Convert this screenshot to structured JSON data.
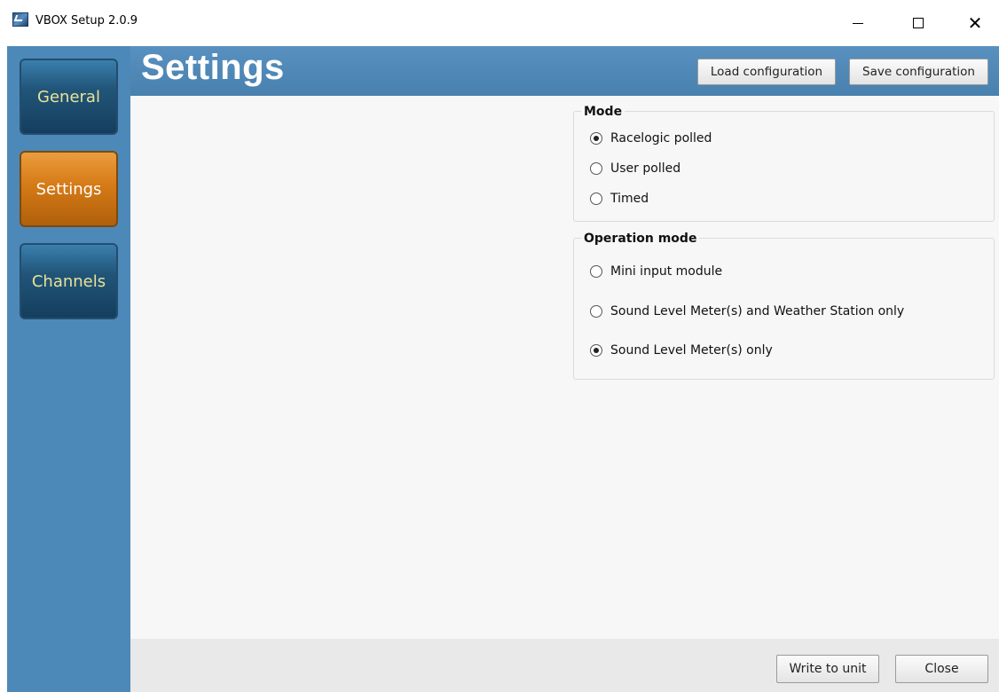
{
  "window": {
    "title": "VBOX Setup 2.0.9",
    "controls": [
      "minimize-icon",
      "maximize-icon",
      "close-icon"
    ]
  },
  "sidebar": {
    "items": [
      {
        "label": "General",
        "active": false
      },
      {
        "label": "Settings",
        "active": true
      },
      {
        "label": "Channels",
        "active": false
      }
    ]
  },
  "header": {
    "title": "Settings",
    "load_label": "Load configuration",
    "save_label": "Save configuration"
  },
  "mode_group": {
    "title": "Mode",
    "options": [
      {
        "label": "Racelogic polled",
        "checked": true
      },
      {
        "label": "User polled",
        "checked": false
      },
      {
        "label": "Timed",
        "checked": false
      }
    ]
  },
  "operation_group": {
    "title": "Operation mode",
    "options": [
      {
        "label": "Mini input module",
        "checked": false
      },
      {
        "label": "Sound Level Meter(s) and Weather Station only",
        "checked": false
      },
      {
        "label": "Sound Level Meter(s) only",
        "checked": true
      }
    ]
  },
  "footer": {
    "write_label": "Write to unit",
    "close_label": "Close"
  },
  "colors": {
    "sidebar_bg": "#4d89b8",
    "nav_active": "#d57a16",
    "nav_inactive": "#215578",
    "header_bg": "#5891c0"
  }
}
